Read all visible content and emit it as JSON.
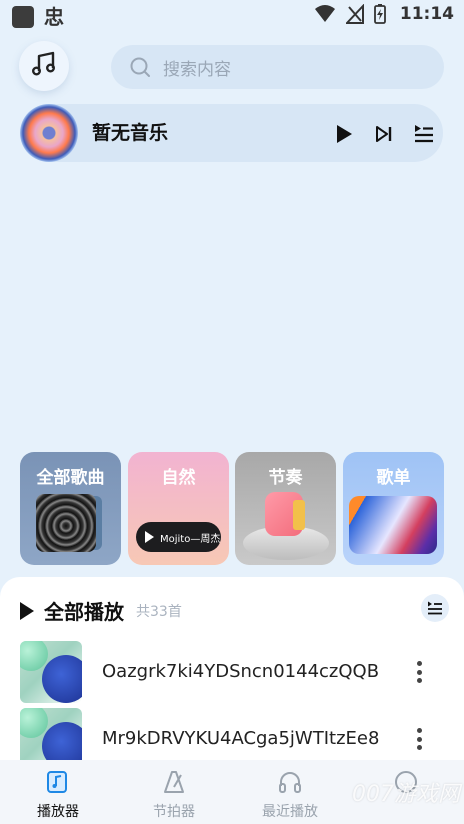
{
  "status_bar": {
    "app_glyph": "忠",
    "time": "11:14"
  },
  "header": {
    "search_placeholder": "搜索内容"
  },
  "now_playing": {
    "title": "暂无音乐"
  },
  "categories": [
    {
      "label": "全部歌曲"
    },
    {
      "label": "自然",
      "pill_text": "Mojito—周杰"
    },
    {
      "label": "节奏"
    },
    {
      "label": "歌单"
    }
  ],
  "play_all": {
    "title": "全部播放",
    "count": "共33首"
  },
  "songs": [
    {
      "title": "Oazgrk7ki4YDSncn0144czQQB"
    },
    {
      "title": "Mr9kDRVYKU4ACga5jWTItzEe8"
    }
  ],
  "bottom_nav": [
    {
      "label": "播放器",
      "icon": "music-note-icon",
      "active": true
    },
    {
      "label": "节拍器",
      "icon": "metronome-icon",
      "active": false
    },
    {
      "label": "最近播放",
      "icon": "headphones-icon",
      "active": false
    },
    {
      "label": "",
      "icon": "profile-icon",
      "active": false
    }
  ],
  "watermark": "007游戏网",
  "colors": {
    "background": "#e6f1fb",
    "accent": "#1e88e5"
  }
}
